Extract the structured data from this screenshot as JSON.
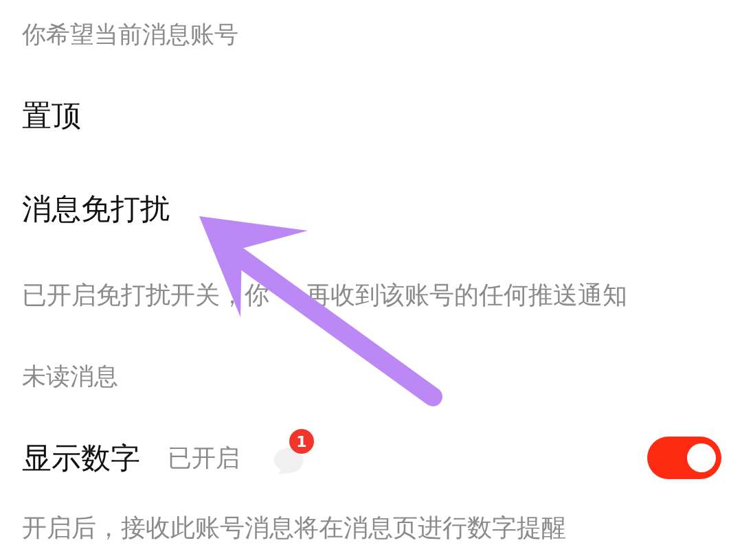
{
  "sections": [
    {
      "kind": "caption",
      "text": "你希望当前消息账号"
    },
    {
      "kind": "option",
      "text": "置顶"
    },
    {
      "kind": "option",
      "text": "消息免打扰"
    },
    {
      "kind": "note",
      "text": "已开启免打扰开关，你",
      "text_after": "再收到该账号的任何推送通知"
    },
    {
      "kind": "caption",
      "text": "未读消息"
    },
    {
      "kind": "toggle",
      "text": "显示数字",
      "status": "已开启",
      "badge": "1",
      "on": true
    },
    {
      "kind": "note",
      "text": "开启后，接收此账号消息将在消息页进行数字提醒"
    }
  ]
}
